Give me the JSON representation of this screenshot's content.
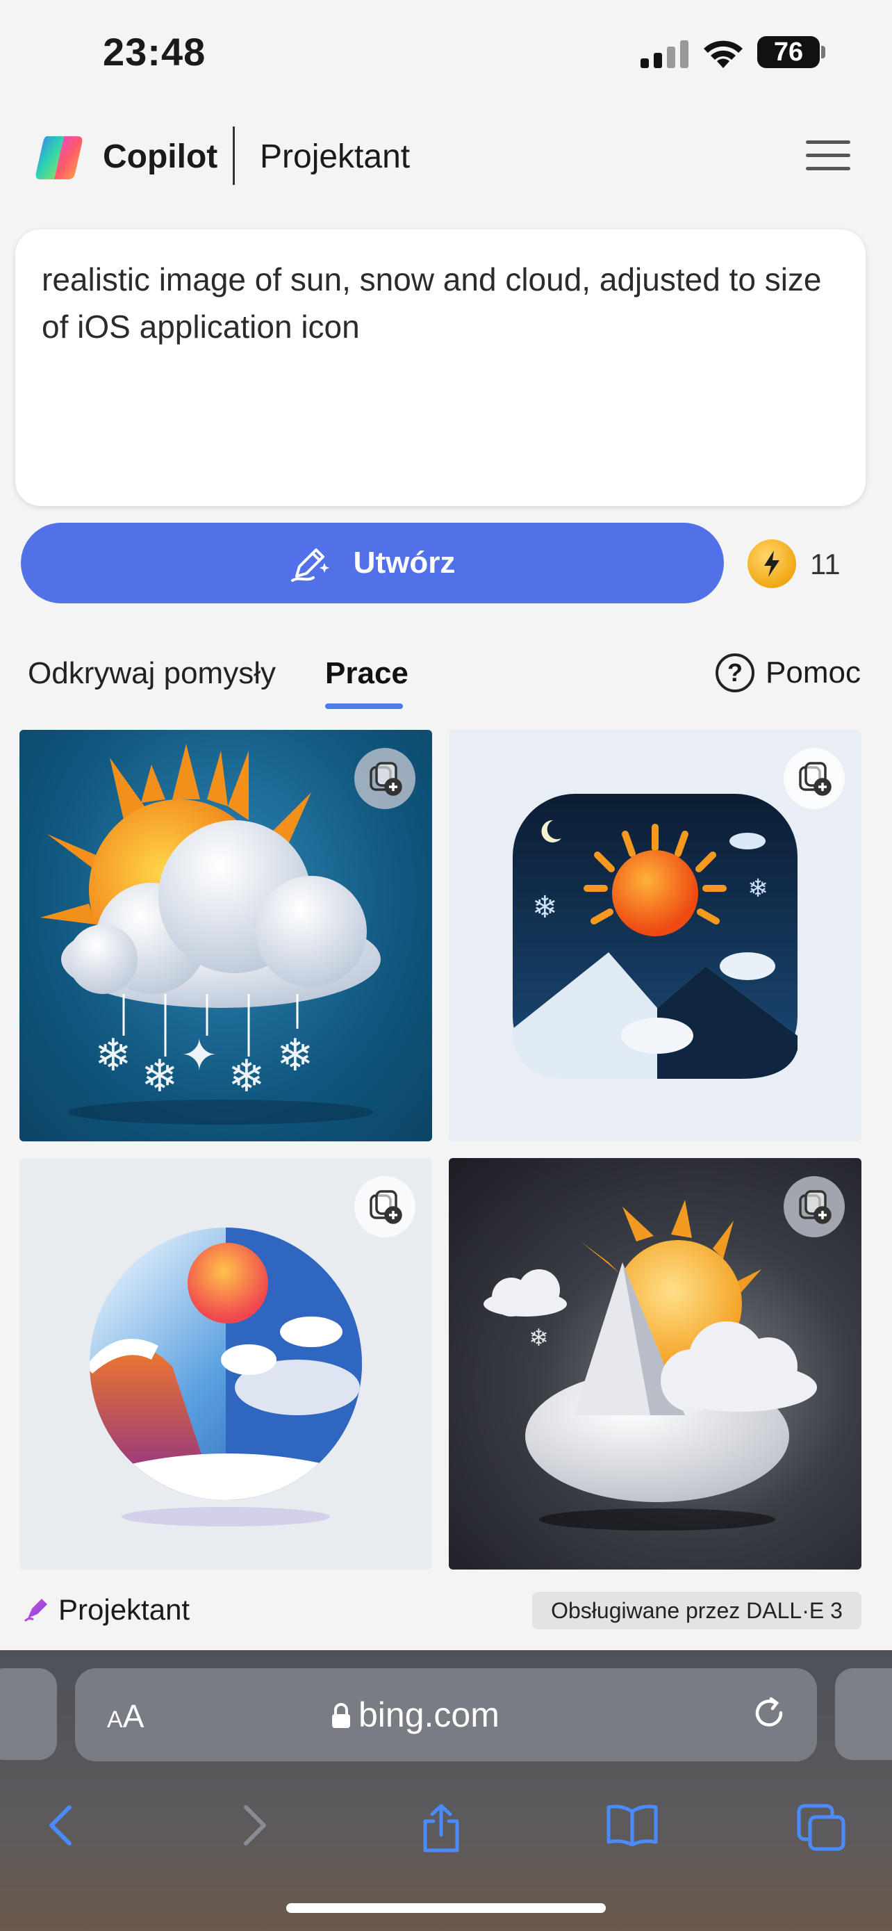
{
  "status_bar": {
    "time": "23:48",
    "battery_level": "76"
  },
  "header": {
    "brand": "Copilot",
    "product": "Projektant"
  },
  "prompt": {
    "text": "realistic image of sun, snow and cloud, adjusted to size of iOS application icon"
  },
  "create": {
    "label": "Utwórz",
    "boost_count": "11"
  },
  "tabs": {
    "explore": "Odkrywaj pomysły",
    "works": "Prace",
    "help": "Pomoc"
  },
  "images": [
    {
      "name": "sun-cloud-snowflakes-blue"
    },
    {
      "name": "sun-mountains-app-icon-dark"
    },
    {
      "name": "sun-mountain-circle-light"
    },
    {
      "name": "sun-snow-mountain-dark"
    }
  ],
  "footer": {
    "brand": "Projektant",
    "powered_by": "Obsługiwane przez DALL·E 3"
  },
  "browser": {
    "text_size_label_small": "A",
    "text_size_label_large": "A",
    "url": "bing.com"
  },
  "colors": {
    "accent": "#5271e8",
    "tab_underline": "#4a7be8",
    "boost_coin": "#f2a816"
  },
  "icons": [
    "copilot-logo",
    "menu-icon",
    "create-pen-icon",
    "boost-coin-icon",
    "help-icon",
    "save-to-collection-icon",
    "designer-icon",
    "lock-icon",
    "reload-icon",
    "back-icon",
    "forward-icon",
    "share-icon",
    "bookmarks-icon",
    "tabs-icon"
  ]
}
